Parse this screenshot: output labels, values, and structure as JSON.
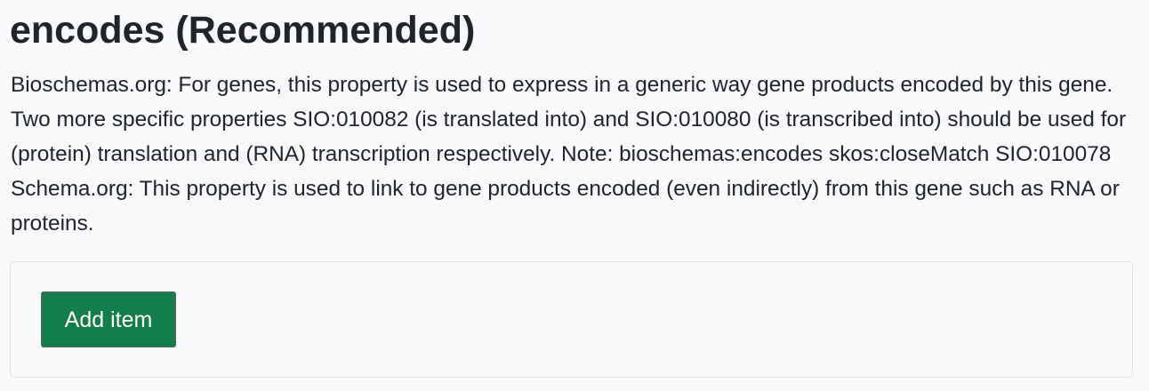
{
  "property": {
    "title": "encodes (Recommended)",
    "description": "Bioschemas.org: For genes, this property is used to express in a generic way gene products encoded by this gene. Two more specific properties SIO:010082 (is translated into) and SIO:010080 (is transcribed into) should be used for (protein) translation and (RNA) transcription respectively. Note: bioschemas:encodes skos:closeMatch SIO:010078 Schema.org: This property is used to link to gene products encoded (even indirectly) from this gene such as RNA or proteins."
  },
  "items_panel": {
    "add_button_label": "Add item"
  },
  "colors": {
    "background": "#f8f9fa",
    "text": "#212529",
    "button_bg": "#137d4c",
    "button_text": "#ffffff",
    "panel_border": "#dee2e6"
  }
}
